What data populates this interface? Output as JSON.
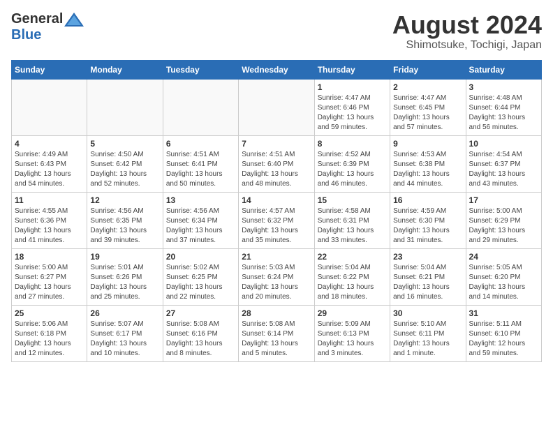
{
  "header": {
    "logo_general": "General",
    "logo_blue": "Blue",
    "month_year": "August 2024",
    "location": "Shimotsuke, Tochigi, Japan"
  },
  "weekdays": [
    "Sunday",
    "Monday",
    "Tuesday",
    "Wednesday",
    "Thursday",
    "Friday",
    "Saturday"
  ],
  "weeks": [
    [
      {
        "day": "",
        "info": ""
      },
      {
        "day": "",
        "info": ""
      },
      {
        "day": "",
        "info": ""
      },
      {
        "day": "",
        "info": ""
      },
      {
        "day": "1",
        "info": "Sunrise: 4:47 AM\nSunset: 6:46 PM\nDaylight: 13 hours\nand 59 minutes."
      },
      {
        "day": "2",
        "info": "Sunrise: 4:47 AM\nSunset: 6:45 PM\nDaylight: 13 hours\nand 57 minutes."
      },
      {
        "day": "3",
        "info": "Sunrise: 4:48 AM\nSunset: 6:44 PM\nDaylight: 13 hours\nand 56 minutes."
      }
    ],
    [
      {
        "day": "4",
        "info": "Sunrise: 4:49 AM\nSunset: 6:43 PM\nDaylight: 13 hours\nand 54 minutes."
      },
      {
        "day": "5",
        "info": "Sunrise: 4:50 AM\nSunset: 6:42 PM\nDaylight: 13 hours\nand 52 minutes."
      },
      {
        "day": "6",
        "info": "Sunrise: 4:51 AM\nSunset: 6:41 PM\nDaylight: 13 hours\nand 50 minutes."
      },
      {
        "day": "7",
        "info": "Sunrise: 4:51 AM\nSunset: 6:40 PM\nDaylight: 13 hours\nand 48 minutes."
      },
      {
        "day": "8",
        "info": "Sunrise: 4:52 AM\nSunset: 6:39 PM\nDaylight: 13 hours\nand 46 minutes."
      },
      {
        "day": "9",
        "info": "Sunrise: 4:53 AM\nSunset: 6:38 PM\nDaylight: 13 hours\nand 44 minutes."
      },
      {
        "day": "10",
        "info": "Sunrise: 4:54 AM\nSunset: 6:37 PM\nDaylight: 13 hours\nand 43 minutes."
      }
    ],
    [
      {
        "day": "11",
        "info": "Sunrise: 4:55 AM\nSunset: 6:36 PM\nDaylight: 13 hours\nand 41 minutes."
      },
      {
        "day": "12",
        "info": "Sunrise: 4:56 AM\nSunset: 6:35 PM\nDaylight: 13 hours\nand 39 minutes."
      },
      {
        "day": "13",
        "info": "Sunrise: 4:56 AM\nSunset: 6:34 PM\nDaylight: 13 hours\nand 37 minutes."
      },
      {
        "day": "14",
        "info": "Sunrise: 4:57 AM\nSunset: 6:32 PM\nDaylight: 13 hours\nand 35 minutes."
      },
      {
        "day": "15",
        "info": "Sunrise: 4:58 AM\nSunset: 6:31 PM\nDaylight: 13 hours\nand 33 minutes."
      },
      {
        "day": "16",
        "info": "Sunrise: 4:59 AM\nSunset: 6:30 PM\nDaylight: 13 hours\nand 31 minutes."
      },
      {
        "day": "17",
        "info": "Sunrise: 5:00 AM\nSunset: 6:29 PM\nDaylight: 13 hours\nand 29 minutes."
      }
    ],
    [
      {
        "day": "18",
        "info": "Sunrise: 5:00 AM\nSunset: 6:27 PM\nDaylight: 13 hours\nand 27 minutes."
      },
      {
        "day": "19",
        "info": "Sunrise: 5:01 AM\nSunset: 6:26 PM\nDaylight: 13 hours\nand 25 minutes."
      },
      {
        "day": "20",
        "info": "Sunrise: 5:02 AM\nSunset: 6:25 PM\nDaylight: 13 hours\nand 22 minutes."
      },
      {
        "day": "21",
        "info": "Sunrise: 5:03 AM\nSunset: 6:24 PM\nDaylight: 13 hours\nand 20 minutes."
      },
      {
        "day": "22",
        "info": "Sunrise: 5:04 AM\nSunset: 6:22 PM\nDaylight: 13 hours\nand 18 minutes."
      },
      {
        "day": "23",
        "info": "Sunrise: 5:04 AM\nSunset: 6:21 PM\nDaylight: 13 hours\nand 16 minutes."
      },
      {
        "day": "24",
        "info": "Sunrise: 5:05 AM\nSunset: 6:20 PM\nDaylight: 13 hours\nand 14 minutes."
      }
    ],
    [
      {
        "day": "25",
        "info": "Sunrise: 5:06 AM\nSunset: 6:18 PM\nDaylight: 13 hours\nand 12 minutes."
      },
      {
        "day": "26",
        "info": "Sunrise: 5:07 AM\nSunset: 6:17 PM\nDaylight: 13 hours\nand 10 minutes."
      },
      {
        "day": "27",
        "info": "Sunrise: 5:08 AM\nSunset: 6:16 PM\nDaylight: 13 hours\nand 8 minutes."
      },
      {
        "day": "28",
        "info": "Sunrise: 5:08 AM\nSunset: 6:14 PM\nDaylight: 13 hours\nand 5 minutes."
      },
      {
        "day": "29",
        "info": "Sunrise: 5:09 AM\nSunset: 6:13 PM\nDaylight: 13 hours\nand 3 minutes."
      },
      {
        "day": "30",
        "info": "Sunrise: 5:10 AM\nSunset: 6:11 PM\nDaylight: 13 hours\nand 1 minute."
      },
      {
        "day": "31",
        "info": "Sunrise: 5:11 AM\nSunset: 6:10 PM\nDaylight: 12 hours\nand 59 minutes."
      }
    ]
  ]
}
